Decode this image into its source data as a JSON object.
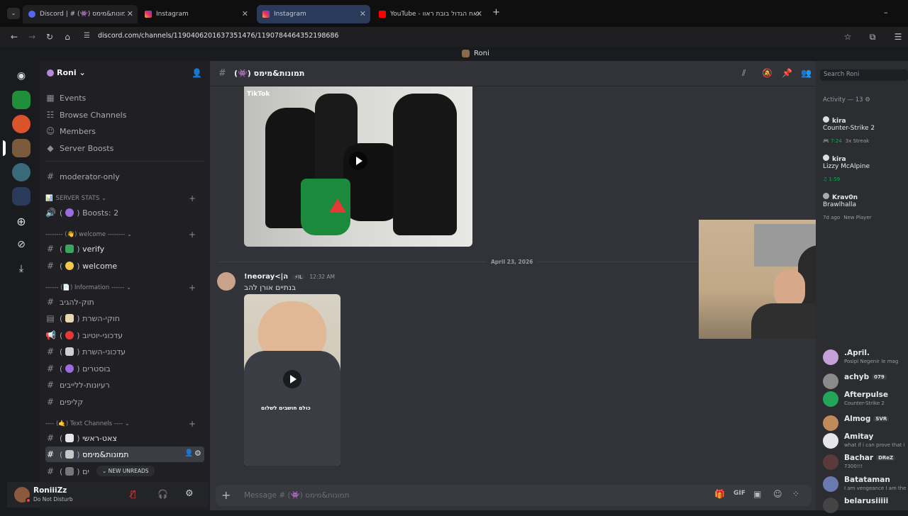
{
  "browser": {
    "tabs": [
      {
        "label": "Discord | # (👾) תמונות&מימס",
        "active": false
      },
      {
        "label": "Instagram",
        "active": false
      },
      {
        "label": "Instagram",
        "active": true
      },
      {
        "label": "YouTube - האח הגדול בובת ראוו",
        "active": false
      }
    ],
    "new_tab": "+",
    "url": "discord.com/channels/1190406201637351476/1190784464352198686",
    "minimize": "–"
  },
  "window": {
    "title": "Roni"
  },
  "server": {
    "name": "Roni"
  },
  "sidebar": {
    "top_items": [
      {
        "icon": "calendar-icon",
        "glyph": "▦",
        "label": "Events"
      },
      {
        "icon": "browse-icon",
        "glyph": "☷",
        "label": "Browse Channels"
      },
      {
        "icon": "members-icon",
        "glyph": "👥",
        "label": "Members"
      },
      {
        "icon": "boost-icon",
        "glyph": "◆",
        "label": "Server Boosts"
      }
    ],
    "moderator_channel": "moderator-only",
    "categories": {
      "stats": "SERVER STATS",
      "welcome": "-------- (👋) welcome --------",
      "information": "------ (📄) Information ------",
      "text": "---- (🤙) Text Channels ----"
    },
    "channels": {
      "boosts": "Boosts: 2",
      "verify": "verify",
      "welcome": "welcome",
      "rules_text": "תוק-להגיב",
      "rules": "חוקי-השרת",
      "youtube": "עדכוני-יוטיוב",
      "server_updates": "עדכוני-השרת",
      "boosters": "בוסטרים",
      "ideas": "רעיונות-ללייבים",
      "clips": "קליפים",
      "main_chat": "צאט-ראשי",
      "memes": "תמונות&מימס",
      "games": "ים"
    },
    "new_unreads": "NEW UNREADS"
  },
  "channel_header": {
    "name": "(👾) תמונות&מימס",
    "search_placeholder": "Search Roni"
  },
  "messages": {
    "date_divider": "April 23, 2026",
    "author": "!neoray<|ה",
    "author_tag": "IL",
    "time": "12:32 AM",
    "text": "בנתיים אורן להב",
    "video1_watermark": "TikTok",
    "video2_caption": "כולם חושבים לשלום"
  },
  "composer": {
    "placeholder": "Message # (👾) תמונות&מימס"
  },
  "user_panel": {
    "name": "RoniiiZz",
    "status": "Do Not Disturb"
  },
  "members": {
    "activity_header": "Activity — 13",
    "activities": [
      {
        "name": "kira",
        "game": "Counter-Strike 2",
        "time": "7:24",
        "extra": "3x Streak"
      },
      {
        "name": "kira",
        "game": "Lizzy McAlpine",
        "time": "1:59",
        "extra": ""
      },
      {
        "name": "Krav0n",
        "game": "Brawlhalla",
        "time": "7d ago",
        "extra": "New Player"
      }
    ],
    "list": [
      {
        "name": ".April.",
        "status": "Posipi Negenir le mag",
        "tag": ""
      },
      {
        "name": "achyb",
        "status": "",
        "tag": "079"
      },
      {
        "name": "Afterpulse",
        "status": "Counter-Strike 2",
        "tag": ""
      },
      {
        "name": "Almog",
        "status": "",
        "tag": "SVR"
      },
      {
        "name": "Amitay",
        "status": "what if i can prove that i",
        "tag": ""
      },
      {
        "name": "Bachar",
        "status": "7300!!!",
        "tag": "DReZ"
      },
      {
        "name": "Batataman",
        "status": "I am vengeance I am the n",
        "tag": ""
      },
      {
        "name": "belarusiiiii",
        "status": "",
        "tag": ""
      }
    ]
  },
  "colors": {
    "background": "#313338",
    "sidebar": "#202024",
    "accent": "#5865f2",
    "green": "#23a55a",
    "red": "#f23f43"
  }
}
